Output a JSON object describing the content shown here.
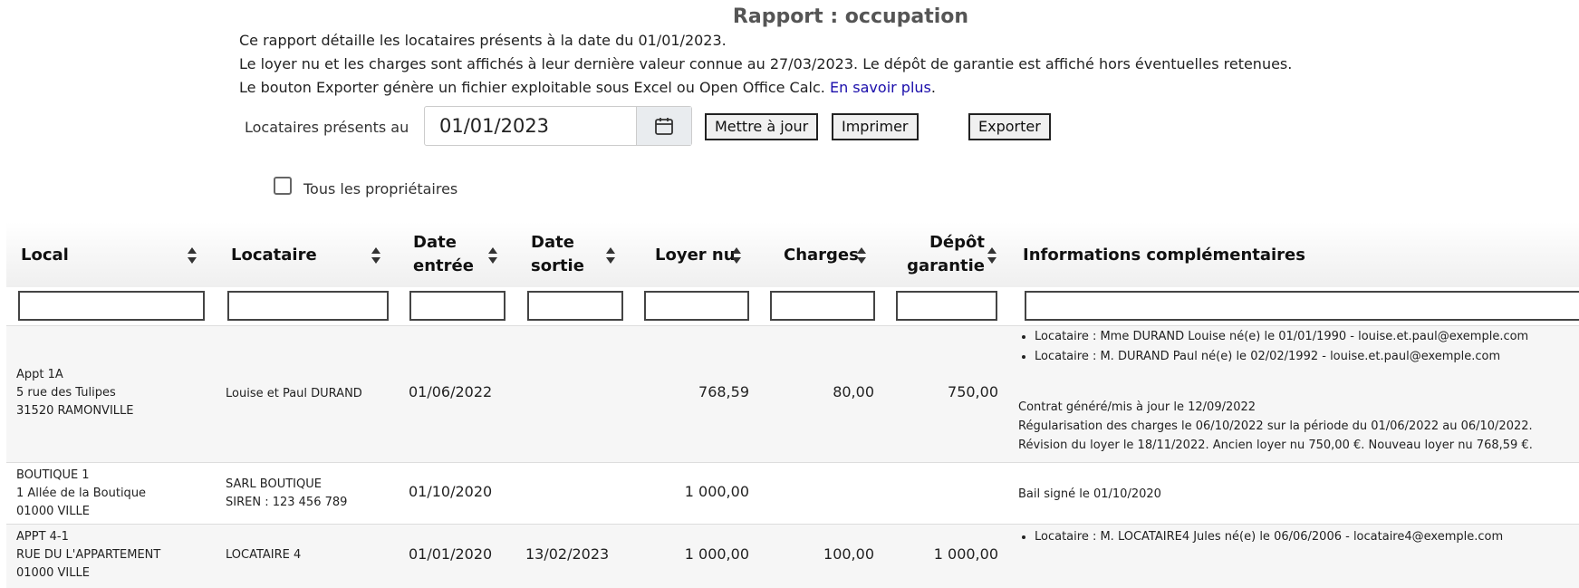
{
  "page": {
    "title": "Rapport : occupation",
    "intro_lines": [
      "Ce rapport détaille les locataires présents à la date du 01/01/2023.",
      "Le loyer nu et les charges sont affichés à leur dernière valeur connue au 27/03/2023. Le dépôt de garantie est affiché hors éventuelles retenues.",
      "Le bouton Exporter génère un fichier exploitable sous Excel ou Open Office Calc."
    ],
    "learn_more": "En savoir plus",
    "learn_more_suffix": "."
  },
  "controls": {
    "date_label": "Locataires présents au",
    "date_value": "01/01/2023",
    "update_label": "Mettre à jour",
    "print_label": "Imprimer",
    "export_label": "Exporter",
    "all_owners_label": "Tous les propriétaires",
    "all_owners_checked": false
  },
  "table": {
    "columns": [
      {
        "key": "local",
        "label": "Local"
      },
      {
        "key": "locataire",
        "label": "Locataire"
      },
      {
        "key": "date_entree",
        "label": "Date entrée",
        "line1": "Date",
        "line2": "entrée"
      },
      {
        "key": "date_sortie",
        "label": "Date sortie",
        "line1": "Date",
        "line2": "sortie"
      },
      {
        "key": "loyer_nu",
        "label": "Loyer nu"
      },
      {
        "key": "charges",
        "label": "Charges"
      },
      {
        "key": "depot",
        "label": "Dépôt garantie",
        "line1": "Dépôt",
        "line2": "garantie"
      },
      {
        "key": "infos",
        "label": "Informations complémentaires"
      }
    ],
    "rows": [
      {
        "local": [
          "Appt 1A",
          "5 rue des Tulipes",
          "31520 RAMONVILLE"
        ],
        "locataire": [
          "Louise et Paul DURAND"
        ],
        "date_entree": "01/06/2022",
        "date_sortie": "",
        "loyer_nu": "768,59",
        "charges": "80,00",
        "depot": "750,00",
        "info_bullets": [
          "Locataire : Mme DURAND Louise né(e) le 01/01/1990 - louise.et.paul@exemple.com",
          "Locataire : M. DURAND Paul né(e) le 02/02/1992 - louise.et.paul@exemple.com"
        ],
        "info_notes": [
          "Contrat généré/mis à jour le 12/09/2022",
          "Régularisation des charges le 06/10/2022 sur la période du 01/06/2022 au 06/10/2022.",
          "Révision du loyer le 18/11/2022. Ancien loyer nu 750,00 €. Nouveau loyer nu 768,59 €."
        ]
      },
      {
        "local": [
          "BOUTIQUE 1",
          "1 Allée de la Boutique",
          "01000 VILLE"
        ],
        "locataire": [
          "SARL BOUTIQUE",
          "SIREN : 123 456 789"
        ],
        "date_entree": "01/10/2020",
        "date_sortie": "",
        "loyer_nu": "1 000,00",
        "charges": "",
        "depot": "",
        "info_bullets": [],
        "info_notes": [
          "Bail signé le 01/10/2020"
        ]
      },
      {
        "local": [
          "APPT 4-1",
          "RUE DU L'APPARTEMENT",
          "01000 VILLE"
        ],
        "locataire": [
          "LOCATAIRE 4"
        ],
        "date_entree": "01/01/2020",
        "date_sortie": "13/02/2023",
        "loyer_nu": "1 000,00",
        "charges": "100,00",
        "depot": "1 000,00",
        "info_bullets": [
          "Locataire : M. LOCATAIRE4 Jules né(e) le 06/06/2006 - locataire4@exemple.com"
        ],
        "info_notes": []
      }
    ]
  }
}
